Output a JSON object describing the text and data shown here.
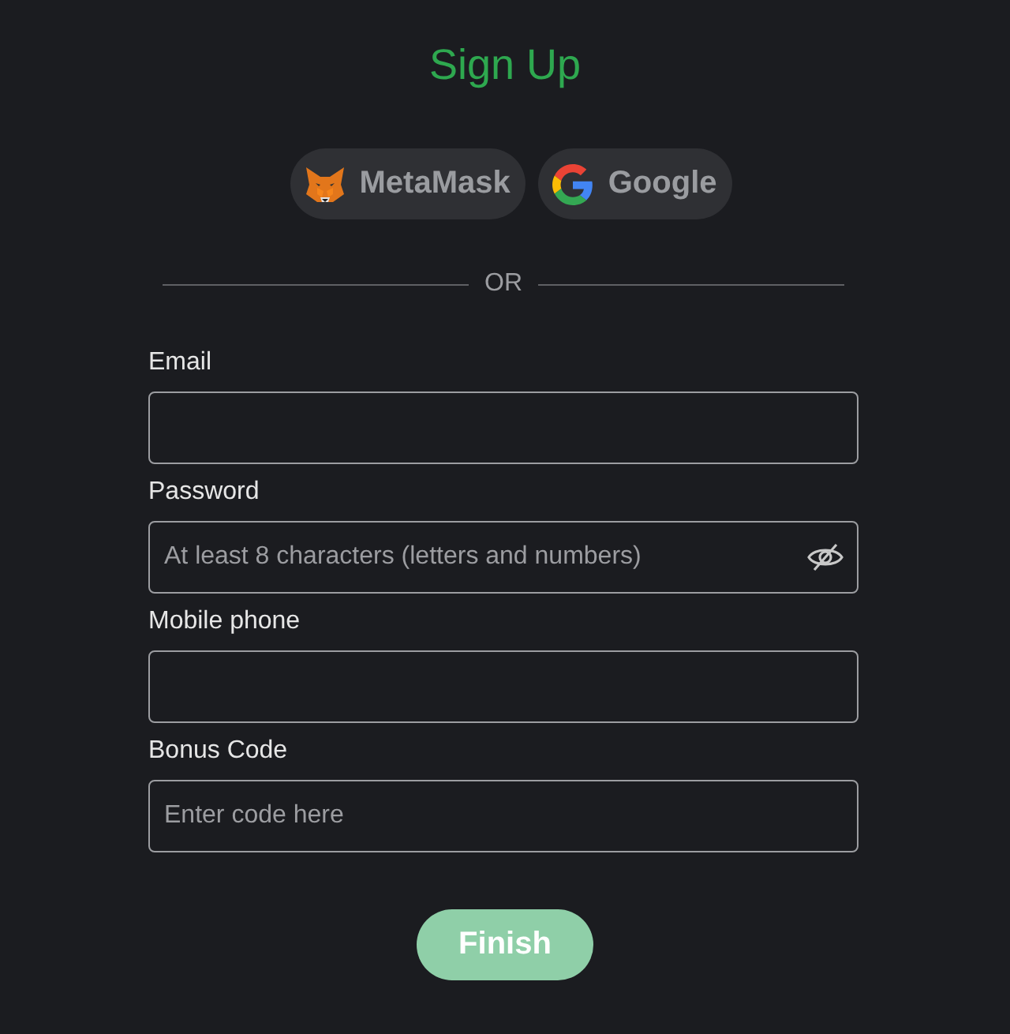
{
  "title": "Sign Up",
  "social_buttons": [
    {
      "kind": "metamask",
      "label": "MetaMask"
    },
    {
      "kind": "google",
      "label": "Google"
    }
  ],
  "divider": "OR",
  "fields": [
    {
      "kind": "text",
      "label": "Email"
    },
    {
      "kind": "password",
      "label": "Password",
      "placeholder": "At least 8 characters (letters and numbers)"
    },
    {
      "kind": "text",
      "label": "Mobile phone"
    },
    {
      "kind": "text",
      "label": "Bonus Code",
      "placeholder": "Enter code here"
    }
  ],
  "submit": "Finish"
}
